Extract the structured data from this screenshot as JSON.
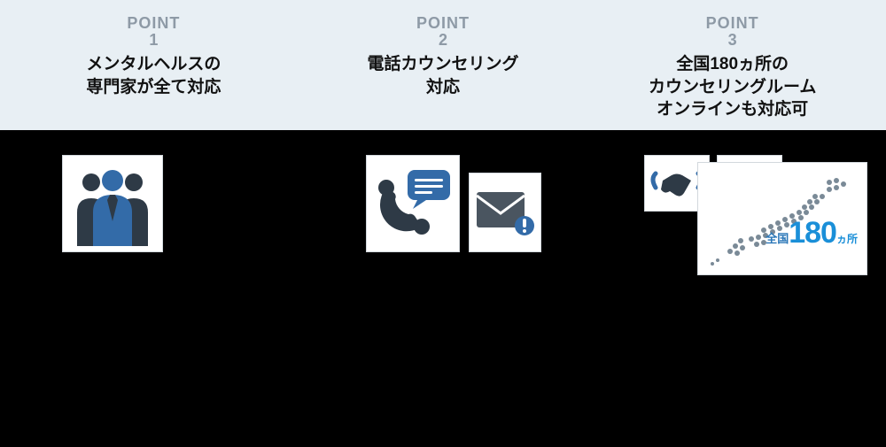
{
  "point_label": "POINT",
  "points": [
    {
      "num": "1",
      "title": "メンタルヘルスの\n専門家が全て対応"
    },
    {
      "num": "2",
      "title": "電話カウンセリング\n対応"
    },
    {
      "num": "3",
      "title": "全国180ヵ所の\nカウンセリングルーム\nオンラインも対応可"
    }
  ],
  "map": {
    "prefix": "全国",
    "number": "180",
    "suffix": "ヵ所"
  }
}
